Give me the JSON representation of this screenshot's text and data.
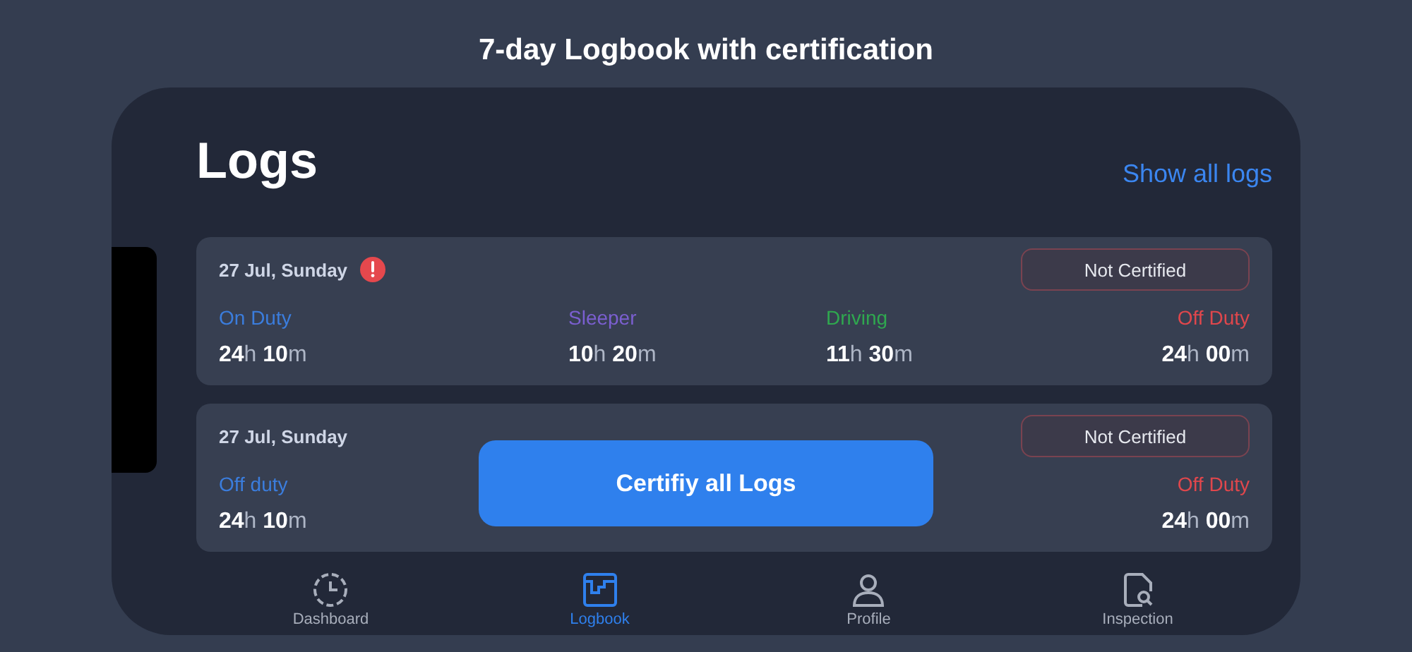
{
  "caption": "7-day Logbook with certification",
  "screen": {
    "title": "Logs",
    "show_all_link": "Show all logs"
  },
  "logs": [
    {
      "date": "27 Jul, Sunday",
      "alert": true,
      "status": "Not Certified",
      "stats": [
        {
          "kind": "on_duty",
          "label": "On Duty",
          "color": "#3b7ddd",
          "value": "**24**h **10**m"
        },
        {
          "kind": "sleeper",
          "label": "Sleeper",
          "color": "#7b5fd0",
          "value": "**10**h **20**m"
        },
        {
          "kind": "driving",
          "label": "Driving",
          "color": "#2fa84f",
          "value": "**11**h **30**m"
        },
        {
          "kind": "off_duty",
          "label": "Off Duty",
          "color": "#e0474c",
          "value": "**24**h **00**m"
        }
      ]
    },
    {
      "date": "27 Jul, Sunday",
      "alert": false,
      "status": "Not Certified",
      "stats": [
        {
          "kind": "on_duty",
          "label": "Off duty",
          "color": "#3b7ddd",
          "value": "**24**h **10**m"
        },
        {
          "kind": "off_duty",
          "label": "Off Duty",
          "color": "#e0474c",
          "value": "**24**h **00**m"
        }
      ]
    }
  ],
  "certify_button": "Certifiy all Logs",
  "tabs": [
    {
      "label": "Dashboard",
      "kind": "clock",
      "selected": false
    },
    {
      "label": "Logbook",
      "kind": "logbook",
      "selected": true
    },
    {
      "label": "Profile",
      "kind": "person",
      "selected": false
    },
    {
      "label": "Inspection",
      "kind": "inspection",
      "selected": false
    }
  ]
}
